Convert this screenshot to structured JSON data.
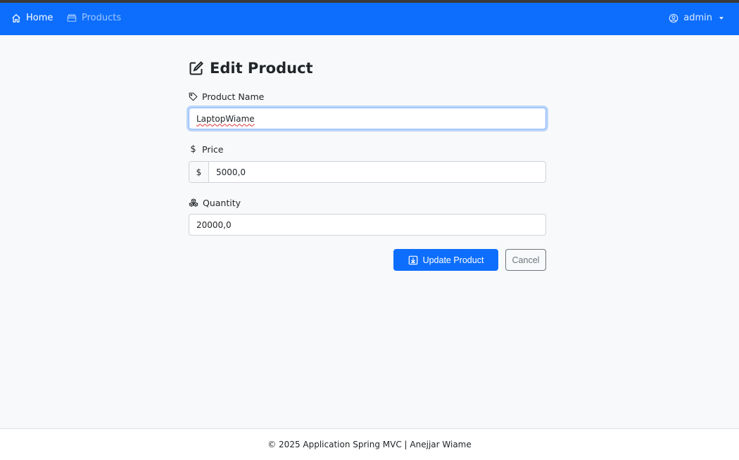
{
  "navbar": {
    "home_label": "Home",
    "products_label": "Products",
    "user_label": "admin",
    "background": "#0d6efd"
  },
  "page": {
    "title": "Edit Product"
  },
  "form": {
    "name_label": "Product Name",
    "name_value": "LaptopWiame",
    "price_label": "Price",
    "price_addon": "$",
    "price_value": "5000,0",
    "quantity_label": "Quantity",
    "quantity_value": "20000,0",
    "update_button": "Update Product",
    "cancel_button": "Cancel"
  },
  "icons": {
    "home": "house-icon",
    "products": "box-icon",
    "user": "person-circle-icon",
    "title": "pencil-square-icon",
    "name": "tag-icon",
    "price": "dollar-icon",
    "quantity": "boxes-icon",
    "update": "download-icon"
  },
  "footer": {
    "text": "© 2025 Application Spring MVC | Anejjar Wiame"
  }
}
